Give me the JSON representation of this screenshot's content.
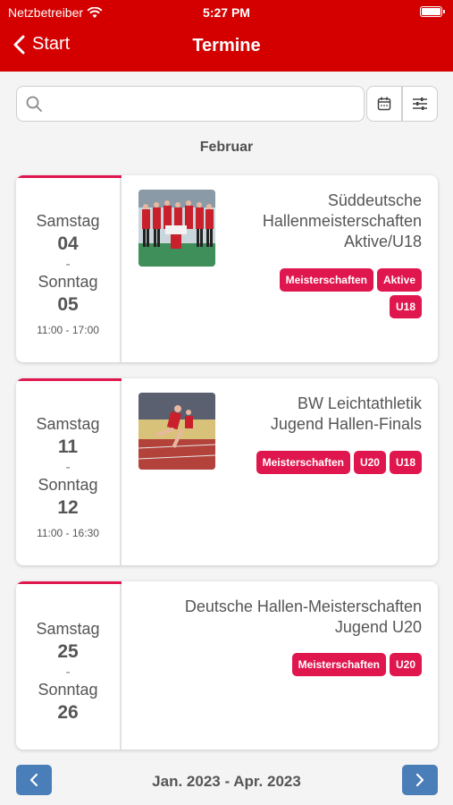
{
  "status": {
    "carrier": "Netzbetreiber",
    "time": "5:27 PM"
  },
  "nav": {
    "back_label": "Start",
    "title": "Termine"
  },
  "search": {
    "placeholder": ""
  },
  "month": "Februar",
  "events": [
    {
      "start_day": "Samstag",
      "start_date": "04",
      "end_day": "Sonntag",
      "end_date": "05",
      "dash": "-",
      "times": "11:00 - 17:00",
      "title_lines": [
        "Süddeutsche",
        "Hallenmeisterschaften",
        "Aktive/U18"
      ],
      "tags": [
        "Meisterschaften",
        "Aktive",
        "U18"
      ]
    },
    {
      "start_day": "Samstag",
      "start_date": "11",
      "end_day": "Sonntag",
      "end_date": "12",
      "dash": "-",
      "times": "11:00 - 16:30",
      "title_lines": [
        "BW Leichtathletik",
        "Jugend Hallen-Finals"
      ],
      "tags": [
        "Meisterschaften",
        "U20",
        "U18"
      ]
    },
    {
      "start_day": "Samstag",
      "start_date": "25",
      "end_day": "Sonntag",
      "end_date": "26",
      "dash": "-",
      "title_lines": [
        "Deutsche Hallen-Meisterschaften",
        "Jugend U20"
      ],
      "tags": [
        "Meisterschaften",
        "U20"
      ]
    }
  ],
  "footer": {
    "range": "Jan. 2023 - Apr. 2023"
  },
  "colors": {
    "brand": "#d40000",
    "tag": "#e0174f",
    "pager": "#4a7eb8"
  }
}
